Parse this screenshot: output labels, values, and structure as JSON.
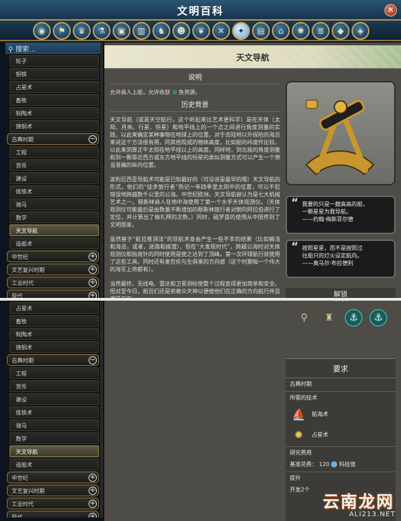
{
  "window": {
    "title": "文明百科",
    "close_icon": "close-icon"
  },
  "categories": [
    {
      "icon": "globe-icon",
      "glyph": "◉"
    },
    {
      "icon": "civ-icon",
      "glyph": "⚑"
    },
    {
      "icon": "trophy-icon",
      "glyph": "♛"
    },
    {
      "icon": "flask-icon",
      "glyph": "⚗"
    },
    {
      "icon": "crate-icon",
      "glyph": "▣"
    },
    {
      "icon": "city-icon",
      "glyph": "▥"
    },
    {
      "icon": "unit-icon",
      "glyph": "♞"
    },
    {
      "icon": "person-icon",
      "glyph": "☻"
    },
    {
      "icon": "leaf-icon",
      "glyph": "❦"
    },
    {
      "icon": "sword-icon",
      "glyph": "✕"
    },
    {
      "icon": "sextant-icon",
      "glyph": "✦",
      "active": true
    },
    {
      "icon": "book-icon",
      "glyph": "▤"
    },
    {
      "icon": "temple-icon",
      "glyph": "⌂"
    },
    {
      "icon": "wings-icon",
      "glyph": "✺"
    },
    {
      "icon": "scroll-icon",
      "glyph": "≣"
    },
    {
      "icon": "shield-icon",
      "glyph": "◆"
    },
    {
      "icon": "map-icon",
      "glyph": "◈"
    }
  ],
  "sidebar": {
    "search_label": "搜索...",
    "items_top": [
      {
        "label": "轮子"
      },
      {
        "label": "铜铁"
      },
      {
        "label": "占星术"
      },
      {
        "label": "畜牧"
      },
      {
        "label": "制陶术"
      },
      {
        "label": "铸铜术"
      },
      {
        "label": "古典时期",
        "header": true,
        "toggle": "−"
      },
      {
        "label": "工程"
      },
      {
        "label": "货币"
      },
      {
        "label": "建设"
      },
      {
        "label": "炼铁术"
      },
      {
        "label": "骑马"
      },
      {
        "label": "数学"
      },
      {
        "label": "天文导航",
        "selected": true
      },
      {
        "label": "造船术"
      },
      {
        "label": "中世纪",
        "header": true,
        "toggle": "+"
      },
      {
        "label": "文艺复兴时期",
        "header": true,
        "toggle": "+"
      },
      {
        "label": "工业时代",
        "header": true,
        "toggle": "+"
      },
      {
        "label": "现代",
        "header": true,
        "toggle": "+"
      }
    ],
    "items_bottom": [
      {
        "label": "占星术"
      },
      {
        "label": "畜牧"
      },
      {
        "label": "制陶术"
      },
      {
        "label": "铸铜术"
      },
      {
        "label": "古典时期",
        "header": true,
        "toggle": "−"
      },
      {
        "label": "工程"
      },
      {
        "label": "货币"
      },
      {
        "label": "建设"
      },
      {
        "label": "炼铁术"
      },
      {
        "label": "骑马"
      },
      {
        "label": "数学"
      },
      {
        "label": "天文导航",
        "selected": true
      },
      {
        "label": "造船术"
      },
      {
        "label": "中世纪",
        "header": true,
        "toggle": "+"
      },
      {
        "label": "文艺复兴时期",
        "header": true,
        "toggle": "+"
      },
      {
        "label": "工业时代",
        "header": true,
        "toggle": "+"
      },
      {
        "label": "现代",
        "header": true,
        "toggle": "+"
      }
    ]
  },
  "article": {
    "page_title": "天文导航",
    "desc_title": "说明",
    "desc_text_a": "允许商人上船，允许收获",
    "desc_text_b": "鱼资源。",
    "history_title": "历史背景",
    "paragraphs": [
      "天文导航（或是天空航行，这个听起来比艺术更科学）是在天体（太阳、月亮、行星、恒星）和地平线上的一个点之间进行角度测量的实践，以此来确定某种事物在地球上的位置。对于去陆地以外探险的海员来说这个方法很有用，同其他现成的物体高度，比如船的纬度作比较，以此来测算正午太阳在地平线以上的高度。同样地，到北极的角度测量和到一颗靠近西方或东方地平线的恒星的类似测量方式可以产生一个想当准确的纵向位置。",
      "波利尼西亚导航术可能是已知最好的（可没说是最早的哦）天文导航的形式。他们的“徒步旅行者”熟记一年四季里太阳中的位置，可以不犯错误地跨越数千公里的公海。中世纪欧洲，天文导航被认为是七大机械艺术之一。穆斯林商人在地中海使用了第一个水手天体观测仪。（天体观测仪可能最后是由数量不断增加的穆斯林旅行者对朝向阿拉伯进行了定位，并计算出了做礼拜的次数。）同时，磁罗盘的使用从中国传到了文明国家。",
      "虽然基于“航位推测法”的导航术身会产生一些不幸的结果（比如搁浅和海浴，或者，迷路和挨饿），但在“大发现时代”，跨越公海时对天体观测仪和指南针的同时使用是使之达到了顶峰。第一次环球航行就使用了这些工具。同时还有麦哲伦与生俱来的方向感（这个时期每一个伟大的海军上将都有）。",
      "当然最终，无线电、雷达和卫星测绘使整个过程变得更加简单和安全。但对至今日，船员们还是依赖众天神以便使他们在正确的方向航行并且避开岩石。"
    ]
  },
  "quotes": [
    {
      "line1": "我要的只是一艘高高的船，",
      "line2": "一颗星星为我导航。",
      "author": "——约翰·梅斯菲尔德"
    },
    {
      "line1": "按照星星，而不是按照过",
      "line2": "往船只的灯火设定航向。",
      "author": "——奥马尔·布拉德利"
    }
  ],
  "unlocks": {
    "title": "解锁",
    "icons": [
      {
        "icon": "buoy-icon",
        "glyph": "⚲",
        "style": "plain"
      },
      {
        "icon": "lighthouse-icon",
        "glyph": "♜",
        "style": "plain"
      },
      {
        "icon": "harbor-anchor-icon",
        "glyph": "⚓",
        "style": "teal"
      },
      {
        "icon": "shipyard-anchor-icon",
        "glyph": "⚓",
        "style": "teal"
      }
    ]
  },
  "requirements": {
    "title": "要求",
    "era": "古典时期",
    "tech_label": "所需的技术",
    "techs": [
      {
        "label": "航海术",
        "icon": "sailing-ship-icon",
        "glyph": "⛵",
        "cls": "ship"
      },
      {
        "label": "占星术",
        "icon": "astrology-icon",
        "glyph": "✹",
        "cls": "sun"
      }
    ],
    "cost_label": "研究费用",
    "base_cost_label": "基准花费：",
    "base_cost_value": "120",
    "cost_unit": "科技值",
    "boost_label": "提升",
    "boost_text": "开发2个"
  },
  "watermark": {
    "cn": "云南龙网",
    "en": "ALI213.NET"
  }
}
